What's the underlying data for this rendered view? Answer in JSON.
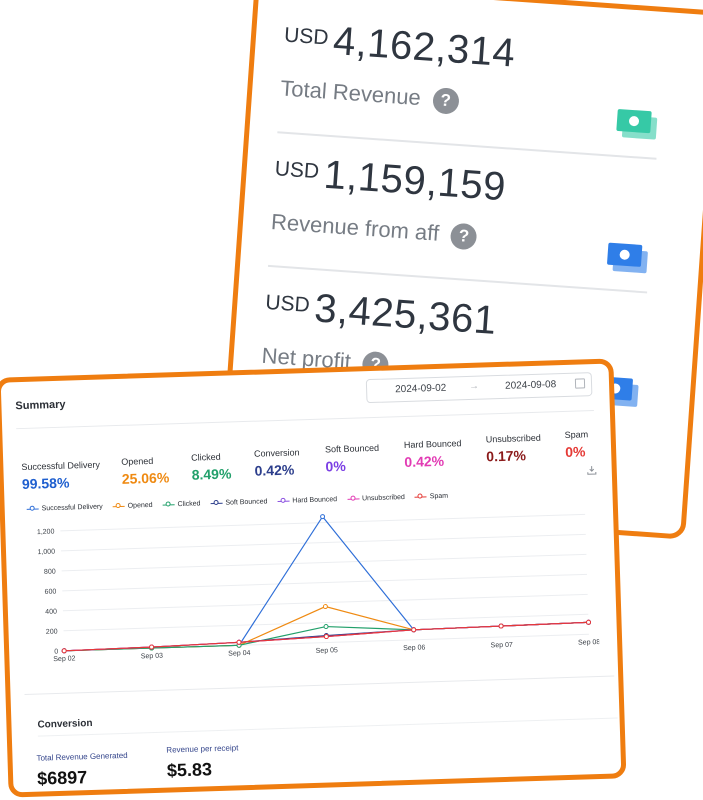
{
  "revenue_cards": [
    {
      "currency": "USD",
      "value": "4,162,314",
      "label": "Total Revenue",
      "icon": "money-icon",
      "icon_color": "#36c9a6"
    },
    {
      "currency": "USD",
      "value": "1,159,159",
      "label": "Revenue from aff",
      "icon": "money-icon",
      "icon_color": "#2f7ee8"
    },
    {
      "currency": "USD",
      "value": "3,425,361",
      "label": "Net profit",
      "icon": "money-icon",
      "icon_color": "#2f7ee8"
    }
  ],
  "summary": {
    "title": "Summary",
    "date_from": "2024-09-02",
    "date_to": "2024-09-08",
    "metrics": [
      {
        "label": "Successful Delivery",
        "value": "99.58%",
        "color": "#1f5fcf"
      },
      {
        "label": "Opened",
        "value": "25.06%",
        "color": "#ef8a12"
      },
      {
        "label": "Clicked",
        "value": "8.49%",
        "color": "#22a06b"
      },
      {
        "label": "Conversion",
        "value": "0.42%",
        "color": "#2c3e8c"
      },
      {
        "label": "Soft Bounced",
        "value": "0%",
        "color": "#7b3fe4"
      },
      {
        "label": "Hard Bounced",
        "value": "0.42%",
        "color": "#e23bb4"
      },
      {
        "label": "Unsubscribed",
        "value": "0.17%",
        "color": "#8b1a1a"
      },
      {
        "label": "Spam",
        "value": "0%",
        "color": "#e53935"
      }
    ]
  },
  "chart_data": {
    "type": "line",
    "x": [
      "Sep 02",
      "Sep 03",
      "Sep 04",
      "Sep 05",
      "Sep 06",
      "Sep 07",
      "Sep 08"
    ],
    "yticks": [
      "0",
      "200",
      "400",
      "600",
      "800",
      "1,000",
      "1,200"
    ],
    "ylim": [
      0,
      1200
    ],
    "grid": true,
    "legend_position": "top",
    "series": [
      {
        "name": "Successful Delivery",
        "color": "#2f6fd8",
        "values": [
          0,
          0,
          0,
          1260,
          100,
          110,
          120
        ]
      },
      {
        "name": "Opened",
        "color": "#ef8a12",
        "values": [
          0,
          0,
          0,
          360,
          100,
          110,
          120
        ]
      },
      {
        "name": "Clicked",
        "color": "#22a06b",
        "values": [
          0,
          0,
          0,
          160,
          100,
          110,
          120
        ]
      },
      {
        "name": "Soft Bounced",
        "color": "#2c3e8c",
        "values": [
          0,
          10,
          30,
          70,
          100,
          110,
          120
        ]
      },
      {
        "name": "Hard Bounced",
        "color": "#8a4fe0",
        "values": [
          0,
          10,
          30,
          60,
          100,
          110,
          120
        ]
      },
      {
        "name": "Unsubscribed",
        "color": "#e23bb4",
        "values": [
          0,
          10,
          30,
          60,
          100,
          110,
          120
        ]
      },
      {
        "name": "Spam",
        "color": "#e53935",
        "values": [
          0,
          10,
          30,
          60,
          100,
          110,
          120
        ]
      }
    ]
  },
  "conversion": {
    "title": "Conversion",
    "kpis": [
      {
        "label": "Total Revenue Generated",
        "value": "$6897"
      },
      {
        "label": "Revenue per receipt",
        "value": "$5.83"
      }
    ]
  }
}
